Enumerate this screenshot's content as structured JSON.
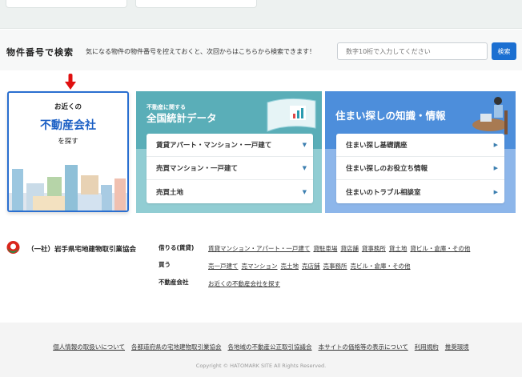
{
  "search": {
    "title": "物件番号で検索",
    "description": "気になる物件の物件番号を控えておくと、次回からはこちらから検索できます！",
    "placeholder": "数字10桁で入力してください",
    "button": "検索"
  },
  "nearby": {
    "line1": "お近くの",
    "line2": "不動産会社",
    "line3": "を探す"
  },
  "stats": {
    "subtitle": "不動産に関する",
    "title": "全国統計データ",
    "items": [
      "賃貸アパート・マンション・一戸建て",
      "売買マンション・一戸建て",
      "売買土地"
    ]
  },
  "knowledge": {
    "title": "住まい探しの知識・情報",
    "items": [
      "住まい探し基礎講座",
      "住まい探しのお役立ち情報",
      "住まいのトラブル相談室"
    ]
  },
  "org": {
    "name": "（一社）岩手県宅地建物取引業協会",
    "groups": [
      {
        "label": "借りる(賃貸)",
        "links": [
          "賃貸マンション・アパート・一戸建て",
          "貸駐車場",
          "貸店舗",
          "貸事務所",
          "貸土地",
          "貸ビル・倉庫・その他"
        ]
      },
      {
        "label": "買う",
        "links": [
          "売一戸建て",
          "売マンション",
          "売土地",
          "売店舗",
          "売事務所",
          "売ビル・倉庫・その他"
        ]
      },
      {
        "label": "不動産会社",
        "links": [
          "お近くの不動産会社を探す"
        ]
      }
    ]
  },
  "footer": {
    "links": [
      "個人情報の取扱いについて",
      "各都道府県の宅地建物取引業協会",
      "各地域の不動産公正取引協議会",
      "本サイトの価格等の表示について",
      "利用規約",
      "推奨環境"
    ],
    "copyright": "Copyright © HATOMARK SITE All Rights Reserved."
  },
  "colors": {
    "accent": "#1b6fd1",
    "teal": "#5aaeb8",
    "blue": "#4d8edb",
    "arrow": "#e01010"
  }
}
